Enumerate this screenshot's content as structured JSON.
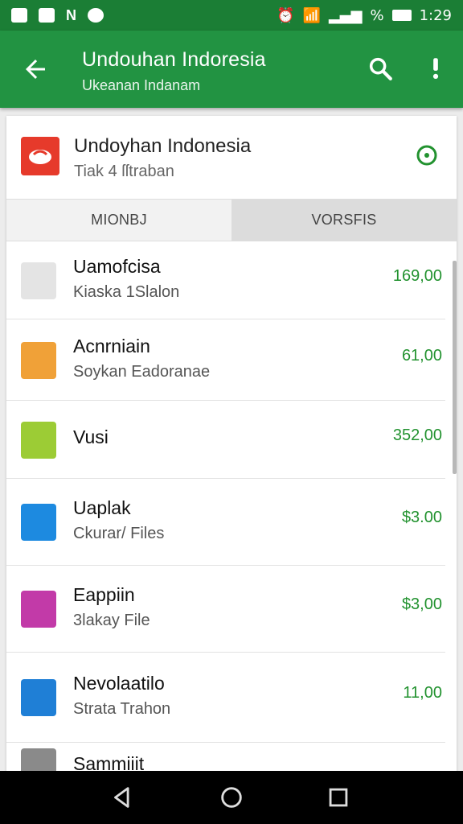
{
  "status_bar": {
    "time": "1:29",
    "battery_label": "%",
    "icons": [
      "image-icon",
      "photo-icon",
      "n-icon",
      "sync-icon",
      "alarm-icon",
      "wifi-icon",
      "signal-icon",
      "battery-icon"
    ]
  },
  "app_bar": {
    "title": "Undouhan Indoresia",
    "subtitle": "Ukeanan Indanam",
    "back_icon": "arrow-back-icon",
    "search_icon": "search-icon",
    "more_icon": "more-vert-icon"
  },
  "header": {
    "name": "Undoyhan Indonesia",
    "meta": "Tiak 4 ſſtraban",
    "icon": "app-icon",
    "status_icon": "target-icon"
  },
  "tabs": [
    {
      "label": "MIONBJ"
    },
    {
      "label": "VORSFIS"
    }
  ],
  "colors": {
    "statusbar": "#1b7e35",
    "appbar": "#229342",
    "price": "#22922f"
  },
  "items": [
    {
      "title": "Uamofcisa",
      "sub": "Kiaska 1Slalon",
      "price": "169,00",
      "icon": "file-icon",
      "color": "#e4e4e4"
    },
    {
      "title": "Acnrniain",
      "sub": "Soykan Eadoranae",
      "price": "61,00",
      "icon": "hash-icon",
      "color": "#f0a138"
    },
    {
      "title": "Vusi",
      "sub": "",
      "price": "352,00",
      "icon": "document-icon",
      "color": "#9ccc35"
    },
    {
      "title": "Uaplak",
      "sub": "Ckurar/ Files",
      "price": "$3.00",
      "icon": "s-icon",
      "color": "#1d8ae0"
    },
    {
      "title": "Eappiin",
      "sub": "3lakay File",
      "price": "$3,00",
      "icon": "flag-icon",
      "color": "#c23aa8"
    },
    {
      "title": "Nevolaatilo",
      "sub": "Strata Trahon",
      "price": "11,00",
      "icon": "dots-icon",
      "color": "#1f7fd6"
    },
    {
      "title": "Sammiiit",
      "sub": "",
      "price": "",
      "icon": "file-icon",
      "color": "#8a8a8a"
    }
  ]
}
